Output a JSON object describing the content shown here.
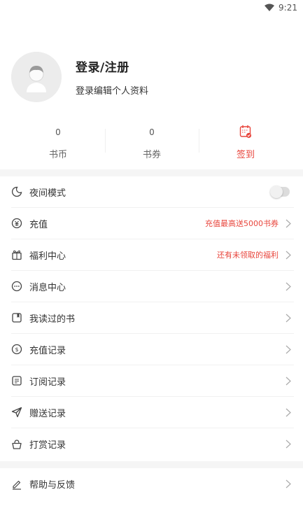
{
  "status_bar": {
    "time": "9:21",
    "wifi_icon": "wifi-icon"
  },
  "profile": {
    "title": "登录/注册",
    "subtitle": "登录编辑个人资料",
    "avatar_icon": "avatar-placeholder"
  },
  "stats": [
    {
      "value": "0",
      "label": "书币"
    },
    {
      "value": "0",
      "label": "书券"
    },
    {
      "icon": "calendar-check-icon",
      "label": "签到"
    }
  ],
  "menu_group_1": [
    {
      "icon": "moon-icon",
      "label": "夜间模式",
      "toggle": "off"
    },
    {
      "icon": "coin-icon",
      "label": "充值",
      "note": "充值最高送5000书券"
    },
    {
      "icon": "gift-icon",
      "label": "福利中心",
      "note": "还有未领取的福利"
    },
    {
      "icon": "message-icon",
      "label": "消息中心"
    },
    {
      "icon": "bookmark-icon",
      "label": "我读过的书"
    },
    {
      "icon": "dollar-icon",
      "label": "充值记录"
    },
    {
      "icon": "list-icon",
      "label": "订阅记录"
    },
    {
      "icon": "send-icon",
      "label": "赠送记录"
    },
    {
      "icon": "basket-icon",
      "label": "打赏记录"
    }
  ],
  "menu_group_2": [
    {
      "icon": "edit-icon",
      "label": "帮助与反馈"
    }
  ],
  "colors": {
    "accent": "#e8453c",
    "divider": "#f5f5f5",
    "text": "#333333"
  }
}
